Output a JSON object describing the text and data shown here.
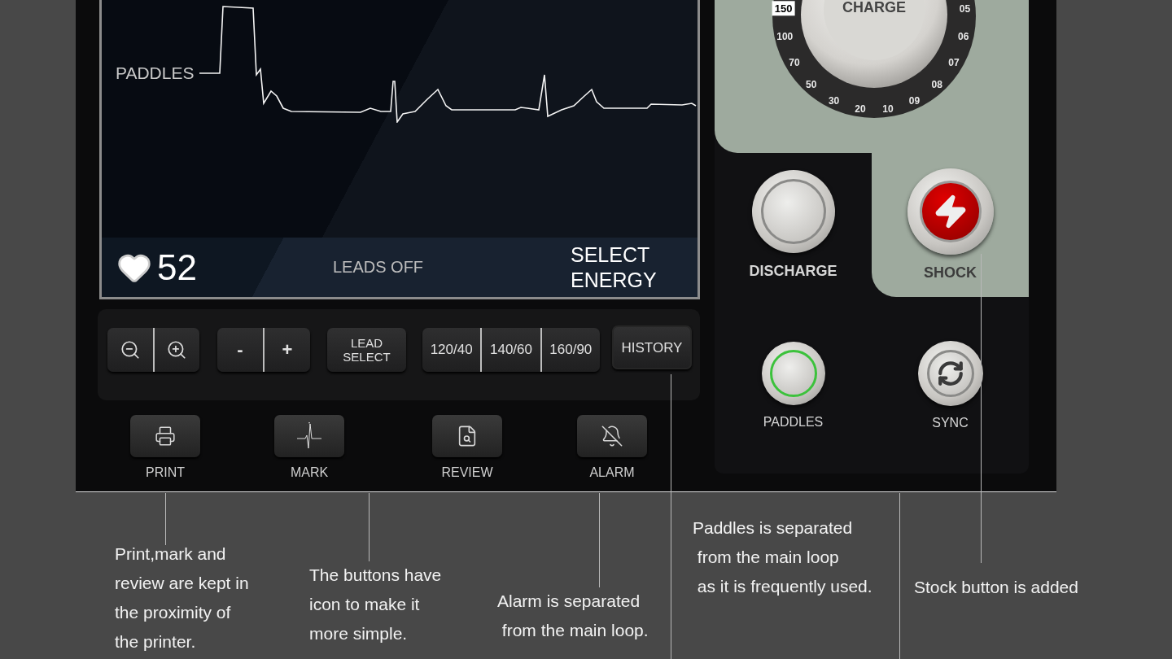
{
  "screen": {
    "trace_label": "PADDLES",
    "heart_rate": "52",
    "status": "LEADS OFF",
    "prompt": "SELECT ENERGY"
  },
  "controls": {
    "adjust": [
      "-",
      "+"
    ],
    "lead_select": "LEAD SELECT",
    "presets": [
      "120/40",
      "140/60",
      "160/90"
    ],
    "history": "HISTORY"
  },
  "function_keys": [
    {
      "kind": "print",
      "label": "PRINT"
    },
    {
      "kind": "mark",
      "label": "MARK"
    },
    {
      "kind": "review",
      "label": "REVIEW"
    },
    {
      "kind": "alarm",
      "label": "ALARM"
    }
  ],
  "dial": {
    "label": "CHARGE",
    "scale": [
      {
        "value": "150",
        "selected": true
      },
      {
        "value": "100",
        "selected": false
      },
      {
        "value": "70",
        "selected": false
      },
      {
        "value": "50",
        "selected": false
      },
      {
        "value": "30",
        "selected": false
      },
      {
        "value": "20",
        "selected": false
      },
      {
        "value": "10",
        "selected": false
      },
      {
        "value": "09",
        "selected": false
      },
      {
        "value": "08",
        "selected": false
      },
      {
        "value": "07",
        "selected": false
      },
      {
        "value": "06",
        "selected": false
      },
      {
        "value": "05",
        "selected": false
      }
    ]
  },
  "buttons": [
    {
      "kind": "discharge",
      "label": "DISCHARGE",
      "lit": false
    },
    {
      "kind": "shock",
      "label": "SHOCK",
      "lit": false
    },
    {
      "kind": "paddles",
      "label": "PADDLES",
      "lit": true
    },
    {
      "kind": "sync",
      "label": "SYNC",
      "lit": false
    }
  ],
  "annotations": [
    {
      "text": "Print,mark and\nreview are kept in\nthe proximity of\nthe printer."
    },
    {
      "text": "The buttons have\nicon to make it\nmore simple."
    },
    {
      "text": "Alarm is separated\n from the main loop."
    },
    {
      "text": "Paddles is separated\n from the main loop\n as it is frequently used."
    },
    {
      "text": "Stock button is added"
    }
  ]
}
